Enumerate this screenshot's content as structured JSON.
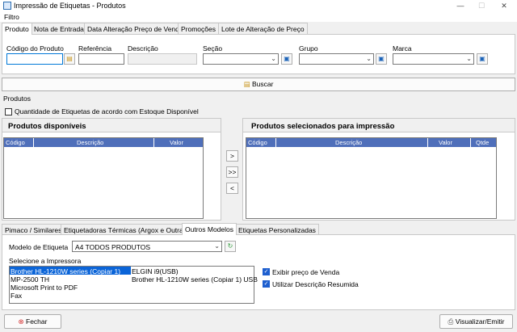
{
  "window": {
    "title": "Impressão de Etiquetas - Produtos"
  },
  "menu": {
    "filtro": "Filtro"
  },
  "top_tabs": [
    "Produto",
    "Nota de Entrada",
    "Data Alteração Preço de Venda",
    "Promoções",
    "Lote de Alteração de Preço"
  ],
  "filter": {
    "codigo_label": "Código do Produto",
    "referencia_label": "Referência",
    "descricao_label": "Descrição",
    "secao_label": "Seção",
    "grupo_label": "Grupo",
    "marca_label": "Marca"
  },
  "buscar_label": "Buscar",
  "produtos_label": "Produtos",
  "qtd_estoque_label": "Quantidade de Etiquetas de acordo com Estoque Disponível",
  "disponiveis": {
    "title": "Produtos disponíveis",
    "cols": [
      "Código",
      "Descrição",
      "Valor"
    ]
  },
  "selecionados": {
    "title": "Produtos selecionados para impressão",
    "cols": [
      "Código",
      "Descrição",
      "Valor",
      "Qtde"
    ]
  },
  "transfer": {
    "add": ">",
    "add_all": ">>",
    "remove": "<"
  },
  "bottom_tabs": [
    "Pimaco / Similares",
    "Etiquetadoras Térmicas (Argox e Outras)",
    "Outros Modelos",
    "Etiquetas Personalizadas"
  ],
  "modelo": {
    "label": "Modelo de Etiqueta",
    "value": "A4 TODOS PRODUTOS"
  },
  "impressora": {
    "label": "Selecione a Impressora",
    "col1": [
      "Brother HL-1210W series (Copiar 1)",
      "MP-2500 TH",
      "Microsoft Print to PDF",
      "Fax"
    ],
    "col2": [
      "ELGIN i9(USB)",
      "Brother HL-1210W series (Copiar 1) USB"
    ]
  },
  "options": {
    "exibir_preco": "Exibir preço de Venda",
    "utilizar_desc": "Utilizar Descrição Resumida"
  },
  "footer": {
    "fechar": "Fechar",
    "visualizar": "Visualizar/Emitir"
  }
}
